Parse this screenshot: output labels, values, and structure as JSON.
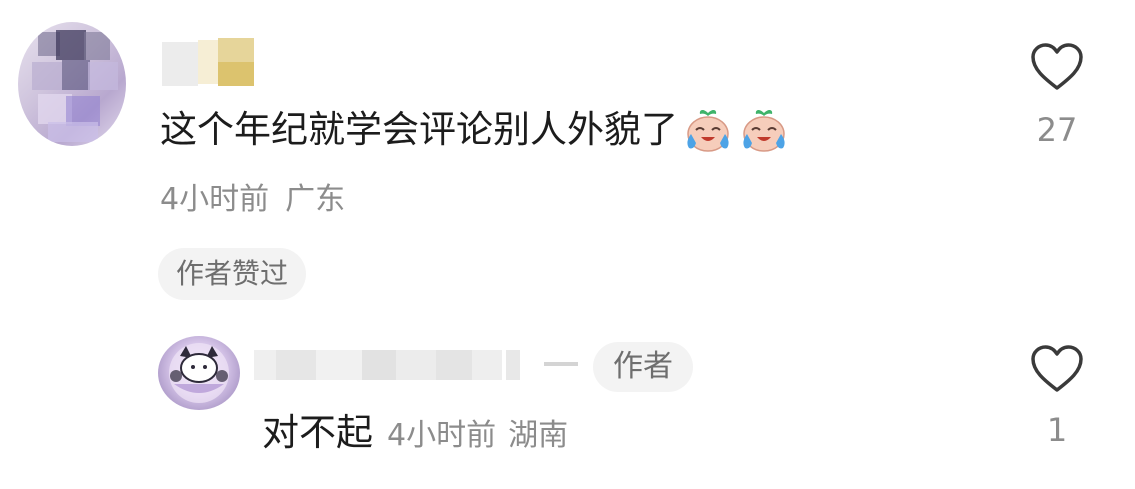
{
  "comment": {
    "text": "这个年纪就学会评论别人外貌了",
    "emojis": [
      "crying-laughing-peach-emoji",
      "crying-laughing-peach-emoji"
    ],
    "time": "4小时前",
    "location": "广东",
    "author_liked_label": "作者赞过",
    "like_count": "27"
  },
  "reply": {
    "author_badge": "作者",
    "text": "对不起",
    "time": "4小时前",
    "location": "湖南",
    "like_count": "1"
  },
  "colors": {
    "text_primary": "#1c1c1c",
    "text_secondary": "#8c8c8c",
    "chip_bg": "#f3f3f3",
    "heart_outline": "#3a3a3a"
  }
}
